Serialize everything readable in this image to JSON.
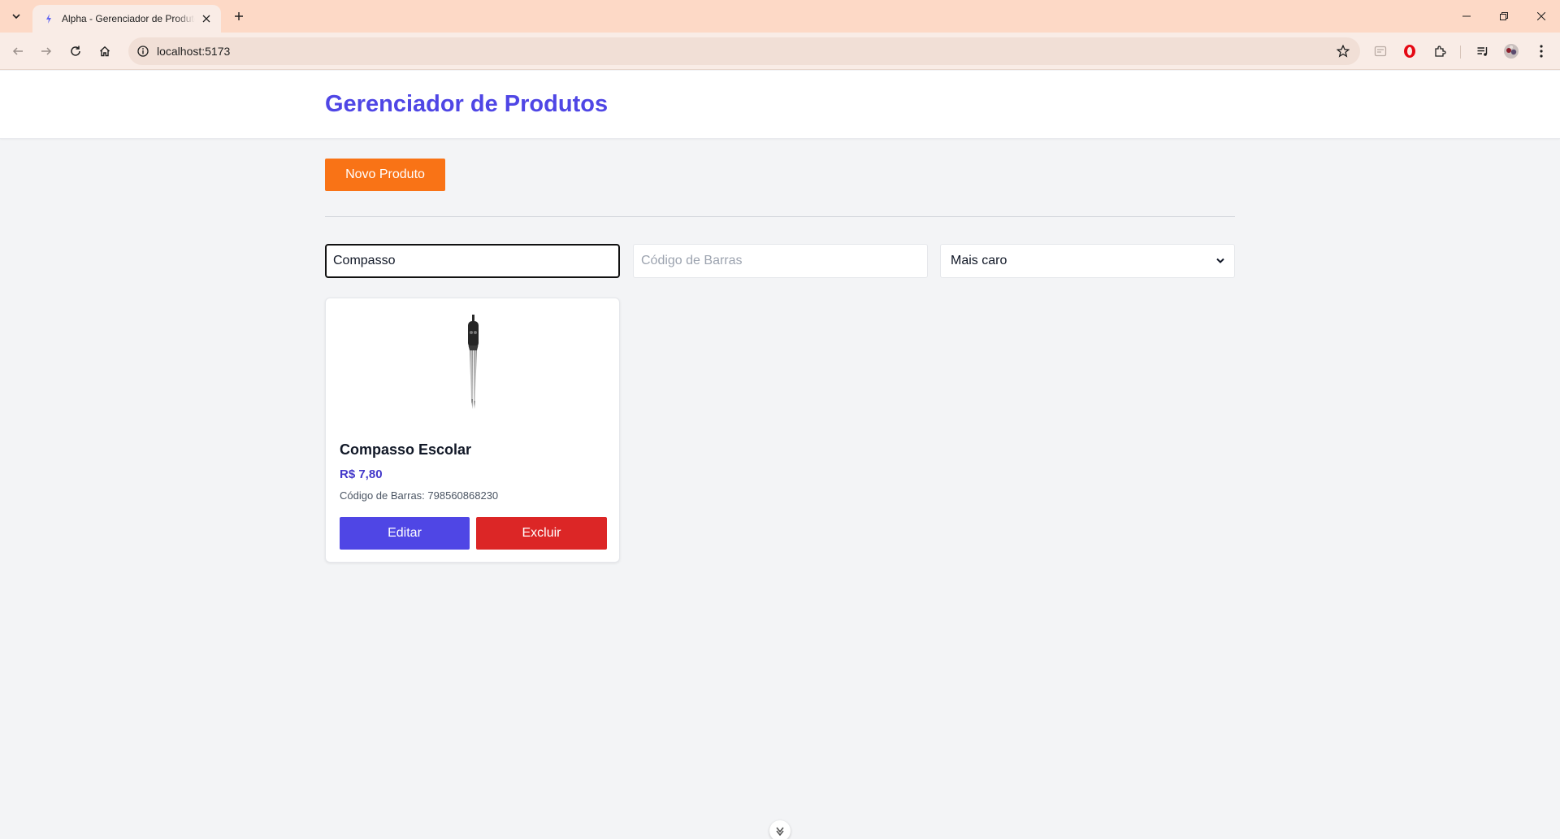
{
  "browser": {
    "tab_title": "Alpha - Gerenciador de Produtos",
    "url": "localhost:5173"
  },
  "app": {
    "title": "Gerenciador de Produtos",
    "new_product_label": "Novo Produto"
  },
  "filters": {
    "name_value": "Compasso",
    "barcode_placeholder": "Código de Barras",
    "barcode_value": "",
    "sort_selected": "Mais caro"
  },
  "products": [
    {
      "name": "Compasso Escolar",
      "price": "R$ 7,80",
      "barcode": "Código de Barras: 798560868230",
      "edit_label": "Editar",
      "delete_label": "Excluir",
      "image_icon": "compass-image"
    }
  ],
  "colors": {
    "accent": "#4f46e5",
    "new_button": "#f97316",
    "delete_button": "#dc2626",
    "tab_bar": "#fdd9c6"
  }
}
